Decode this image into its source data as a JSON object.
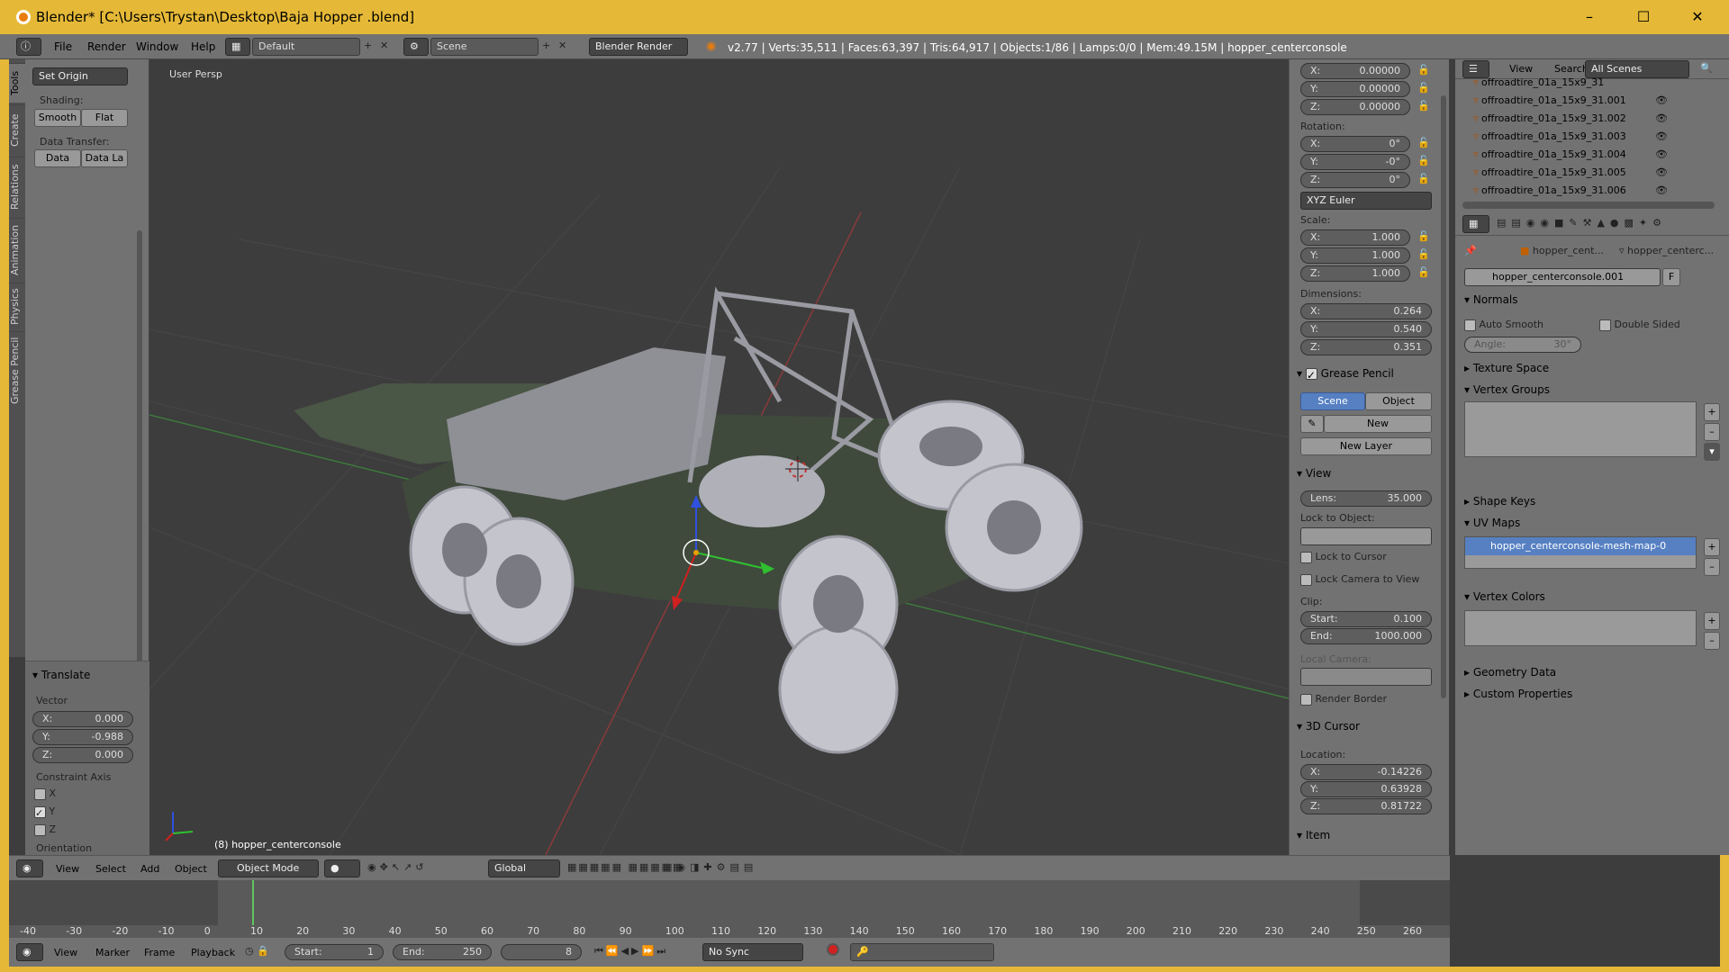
{
  "window": {
    "title": "Blender* [C:\\Users\\Trystan\\Desktop\\Baja Hopper .blend]"
  },
  "topbar": {
    "menus": [
      "File",
      "Render",
      "Window",
      "Help"
    ],
    "layout": "Default",
    "scene": "Scene",
    "engine": "Blender Render",
    "stats": "v2.77 | Verts:35,511 | Faces:63,397 | Tris:64,917 | Objects:1/86 | Lamps:0/0 | Mem:49.15M | hopper_centerconsole"
  },
  "lefttabs": [
    "Tools",
    "Create",
    "Relations",
    "Animation",
    "Physics",
    "Grease Pencil"
  ],
  "toolshelf": {
    "set_origin": "Set Origin",
    "shading_label": "Shading:",
    "smooth": "Smooth",
    "flat": "Flat",
    "data_transfer_label": "Data Transfer:",
    "data": "Data",
    "data_la": "Data La",
    "translate": "Translate",
    "vector_label": "Vector",
    "vx": {
      "k": "X:",
      "v": "0.000"
    },
    "vy": {
      "k": "Y:",
      "v": "-0.988"
    },
    "vz": {
      "k": "Z:",
      "v": "0.000"
    },
    "constraint_label": "Constraint Axis",
    "ax_x": "X",
    "ax_y": "Y",
    "ax_z": "Z",
    "orientation_label": "Orientation"
  },
  "viewport": {
    "persp_label": "User Persp",
    "object_label": "(8) hopper_centerconsole"
  },
  "npanel": {
    "loc": [
      {
        "k": "X:",
        "v": "0.00000"
      },
      {
        "k": "Y:",
        "v": "0.00000"
      },
      {
        "k": "Z:",
        "v": "0.00000"
      }
    ],
    "rotation_label": "Rotation:",
    "rot": [
      {
        "k": "X:",
        "v": "0°"
      },
      {
        "k": "Y:",
        "v": "-0°"
      },
      {
        "k": "Z:",
        "v": "0°"
      }
    ],
    "rot_mode": "XYZ Euler",
    "scale_label": "Scale:",
    "scale": [
      {
        "k": "X:",
        "v": "1.000"
      },
      {
        "k": "Y:",
        "v": "1.000"
      },
      {
        "k": "Z:",
        "v": "1.000"
      }
    ],
    "dim_label": "Dimensions:",
    "dim": [
      {
        "k": "X:",
        "v": "0.264"
      },
      {
        "k": "Y:",
        "v": "0.540"
      },
      {
        "k": "Z:",
        "v": "0.351"
      }
    ],
    "grease_pencil": "Grease Pencil",
    "gp_scene": "Scene",
    "gp_object": "Object",
    "gp_new": "New",
    "gp_new_layer": "New Layer",
    "view": "View",
    "lens": {
      "k": "Lens:",
      "v": "35.000"
    },
    "lock_to_object": "Lock to Object:",
    "lock_to_cursor": "Lock to Cursor",
    "lock_cam": "Lock Camera to View",
    "clip_label": "Clip:",
    "clip_start": {
      "k": "Start:",
      "v": "0.100"
    },
    "clip_end": {
      "k": "End:",
      "v": "1000.000"
    },
    "local_camera": "Local Camera:",
    "render_border": "Render Border",
    "cursor_3d": "3D Cursor",
    "location_label": "Location:",
    "cur": [
      {
        "k": "X:",
        "v": "-0.14226"
      },
      {
        "k": "Y:",
        "v": "0.63928"
      },
      {
        "k": "Z:",
        "v": "0.81722"
      }
    ],
    "item": "Item"
  },
  "outliner": {
    "menu_view": "View",
    "menu_search": "Search",
    "filter": "All Scenes",
    "rows": [
      "offroadtire_01a_15x9_31",
      "offroadtire_01a_15x9_31.001",
      "offroadtire_01a_15x9_31.002",
      "offroadtire_01a_15x9_31.003",
      "offroadtire_01a_15x9_31.004",
      "offroadtire_01a_15x9_31.005",
      "offroadtire_01a_15x9_31.006"
    ]
  },
  "props": {
    "crumb1": "hopper_cent...",
    "crumb2": "hopper_centerc...",
    "mesh_name": "hopper_centerconsole.001",
    "f_btn": "F",
    "normals": "Normals",
    "auto_smooth": "Auto Smooth",
    "double_sided": "Double Sided",
    "angle": {
      "k": "Angle:",
      "v": "30°"
    },
    "texture_space": "Texture Space",
    "vertex_groups": "Vertex Groups",
    "shape_keys": "Shape Keys",
    "uv_maps": "UV Maps",
    "uv_item": "hopper_centerconsole-mesh-map-0",
    "vertex_colors": "Vertex Colors",
    "geometry_data": "Geometry Data",
    "custom_props": "Custom Properties"
  },
  "vpheader": {
    "view": "View",
    "select": "Select",
    "add": "Add",
    "object": "Object",
    "mode": "Object Mode",
    "orientation": "Global"
  },
  "timeline": {
    "ticks": [
      "-40",
      "-30",
      "-20",
      "-10",
      "0",
      "10",
      "20",
      "30",
      "40",
      "50",
      "60",
      "70",
      "80",
      "90",
      "100",
      "110",
      "120",
      "130",
      "140",
      "150",
      "160",
      "170",
      "180",
      "190",
      "200",
      "210",
      "220",
      "230",
      "240",
      "250",
      "260"
    ],
    "current_frame": 8
  },
  "tlheader": {
    "view": "View",
    "marker": "Marker",
    "frame": "Frame",
    "playback": "Playback",
    "start": {
      "k": "Start:",
      "v": "1"
    },
    "end": {
      "k": "End:",
      "v": "250"
    },
    "frame_value": "8",
    "sync": "No Sync"
  },
  "colors": {
    "accent": "#e5b937",
    "selection": "#5680c2",
    "panel": "#727272",
    "viewport": "#3d3d3d"
  }
}
